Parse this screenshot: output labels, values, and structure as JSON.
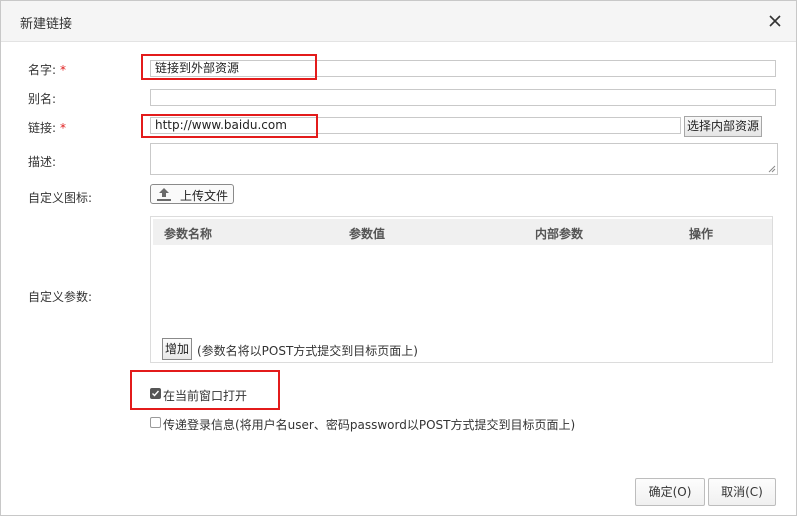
{
  "dialog": {
    "title": "新建链接",
    "close_icon": "close-icon"
  },
  "form": {
    "name": {
      "label": "名字:",
      "required_mark": "*",
      "value": "链接到外部资源"
    },
    "alias": {
      "label": "别名:",
      "value": ""
    },
    "link": {
      "label": "链接:",
      "required_mark": "*",
      "value": "http://www.baidu.com",
      "choose_button": "选择内部资源"
    },
    "description": {
      "label": "描述:",
      "value": ""
    },
    "icon": {
      "label": "自定义图标:",
      "upload_button": "上传文件",
      "upload_icon": "upload-icon"
    },
    "params": {
      "label": "自定义参数:",
      "columns": [
        "参数名称",
        "参数值",
        "内部参数",
        "操作"
      ],
      "add_button": "增加",
      "note": "(参数名将以POST方式提交到目标页面上)"
    },
    "open_current_window": {
      "label": "在当前窗口打开",
      "checked": true
    },
    "pass_login": {
      "label": "传递登录信息(将用户名user、密码password以POST方式提交到目标页面上)",
      "checked": false
    }
  },
  "footer": {
    "ok_button": "确定(O)",
    "cancel_button": "取消(C)"
  },
  "colors": {
    "highlight": "#e31b1b",
    "required": "#e02020"
  }
}
